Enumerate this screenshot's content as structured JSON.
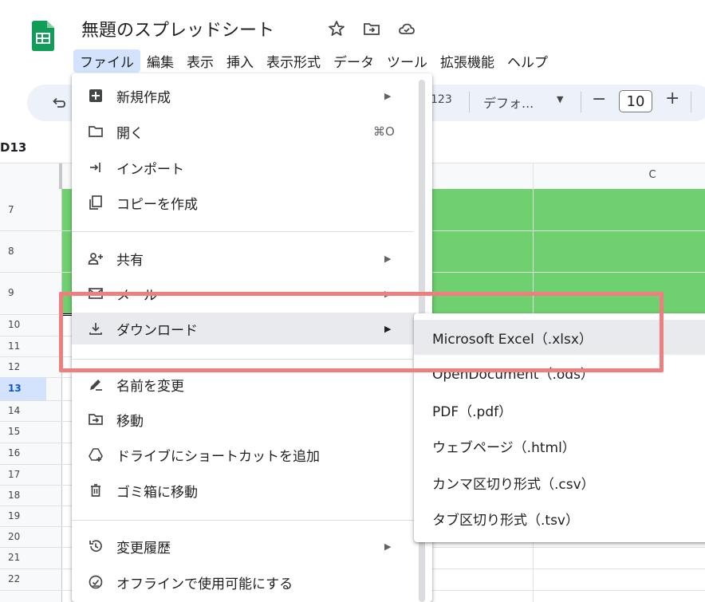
{
  "app": {
    "doc_title": "無題のスプレッドシート",
    "accent_color": "#0f9d58"
  },
  "menubar": [
    {
      "label": "ファイル",
      "active": true
    },
    {
      "label": "編集"
    },
    {
      "label": "表示"
    },
    {
      "label": "挿入"
    },
    {
      "label": "表示形式"
    },
    {
      "label": "データ"
    },
    {
      "label": "ツール"
    },
    {
      "label": "拡張機能"
    },
    {
      "label": "ヘルプ"
    }
  ],
  "toolbar": {
    "format_partial": "123",
    "font_family": "デフォ...",
    "font_size": "10",
    "minus": "−",
    "plus": "+"
  },
  "name_box": "D13",
  "grid": {
    "col_c": "C",
    "rows": [
      "7",
      "8",
      "9",
      "10",
      "11",
      "12",
      "13",
      "14",
      "15",
      "16",
      "17",
      "18",
      "19",
      "20",
      "21",
      "22"
    ],
    "selected_row": "13",
    "fill_color": "#6fd06f"
  },
  "file_menu": {
    "items": [
      {
        "label": "新規作成",
        "icon": "new-icon",
        "submenu": true
      },
      {
        "label": "開く",
        "icon": "folder-icon",
        "shortcut": "⌘O"
      },
      {
        "label": "インポート",
        "icon": "import-icon"
      },
      {
        "label": "コピーを作成",
        "icon": "copy-icon"
      },
      {
        "label": "共有",
        "icon": "share-icon",
        "submenu": true
      },
      {
        "label": "メール",
        "icon": "mail-icon",
        "submenu": true
      },
      {
        "label": "ダウンロード",
        "icon": "download-icon",
        "submenu": true,
        "hover": true
      },
      {
        "label": "名前を変更",
        "icon": "rename-icon"
      },
      {
        "label": "移動",
        "icon": "move-icon"
      },
      {
        "label": "ドライブにショートカットを追加",
        "icon": "drive-shortcut-icon"
      },
      {
        "label": "ゴミ箱に移動",
        "icon": "trash-icon"
      },
      {
        "label": "変更履歴",
        "icon": "history-icon",
        "submenu": true
      },
      {
        "label": "オフラインで使用可能にする",
        "icon": "offline-icon"
      }
    ]
  },
  "download_submenu": {
    "items": [
      {
        "label": "Microsoft Excel（.xlsx）",
        "hover": true
      },
      {
        "label": "OpenDocument（.ods）"
      },
      {
        "label": "PDF（.pdf）"
      },
      {
        "label": "ウェブページ（.html）"
      },
      {
        "label": "カンマ区切り形式（.csv）"
      },
      {
        "label": "タブ区切り形式（.tsv）"
      }
    ]
  },
  "annotation": {
    "highlight_color": "#ef7f7f"
  }
}
